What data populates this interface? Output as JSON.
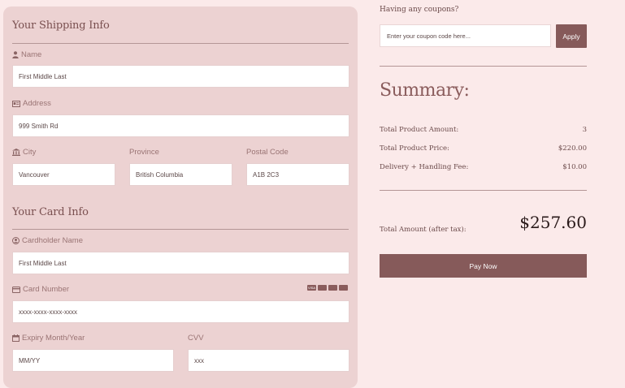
{
  "shipping": {
    "title": "Your Shipping Info",
    "name_label": "Name",
    "name_value": "First Middle Last",
    "address_label": "Address",
    "address_value": "999 Smith Rd",
    "city_label": "City",
    "city_value": "Vancouver",
    "province_label": "Province",
    "province_value": "British Columbia",
    "postal_label": "Postal Code",
    "postal_value": "A1B 2C3"
  },
  "card": {
    "title": "Your Card Info",
    "holder_label": "Cardholder Name",
    "holder_value": "First Middle Last",
    "number_label": "Card Number",
    "number_value": "xxxx-xxxx-xxxx-xxxx",
    "card_brands": [
      "VISA",
      "",
      "",
      ""
    ],
    "expiry_label": "Expiry Month/Year",
    "expiry_value": "MM/YY",
    "cvv_label": "CVV",
    "cvv_value": "xxx"
  },
  "coupon": {
    "label": "Having any coupons?",
    "placeholder": "Enter your coupon code here...",
    "apply_label": "Apply"
  },
  "summary": {
    "title": "Summary:",
    "rows": [
      {
        "label": "Total Product Amount:",
        "value": "3"
      },
      {
        "label": "Total Product Price:",
        "value": "$220.00"
      },
      {
        "label": "Delivery + Handling Fee:",
        "value": "$10.00"
      }
    ],
    "total_label": "Total Amount (after tax):",
    "total_value": "$257.60",
    "pay_label": "Pay Now"
  },
  "icons": {
    "name": "user-icon",
    "address": "id-card-icon",
    "city": "building-icon",
    "holder": "user-circle-icon",
    "number": "credit-card-icon",
    "expiry": "calendar-icon"
  },
  "colors": {
    "background": "#fbeaea",
    "panel": "#ecd2d2",
    "accent": "#865a5a",
    "text": "#8a5c5c"
  }
}
